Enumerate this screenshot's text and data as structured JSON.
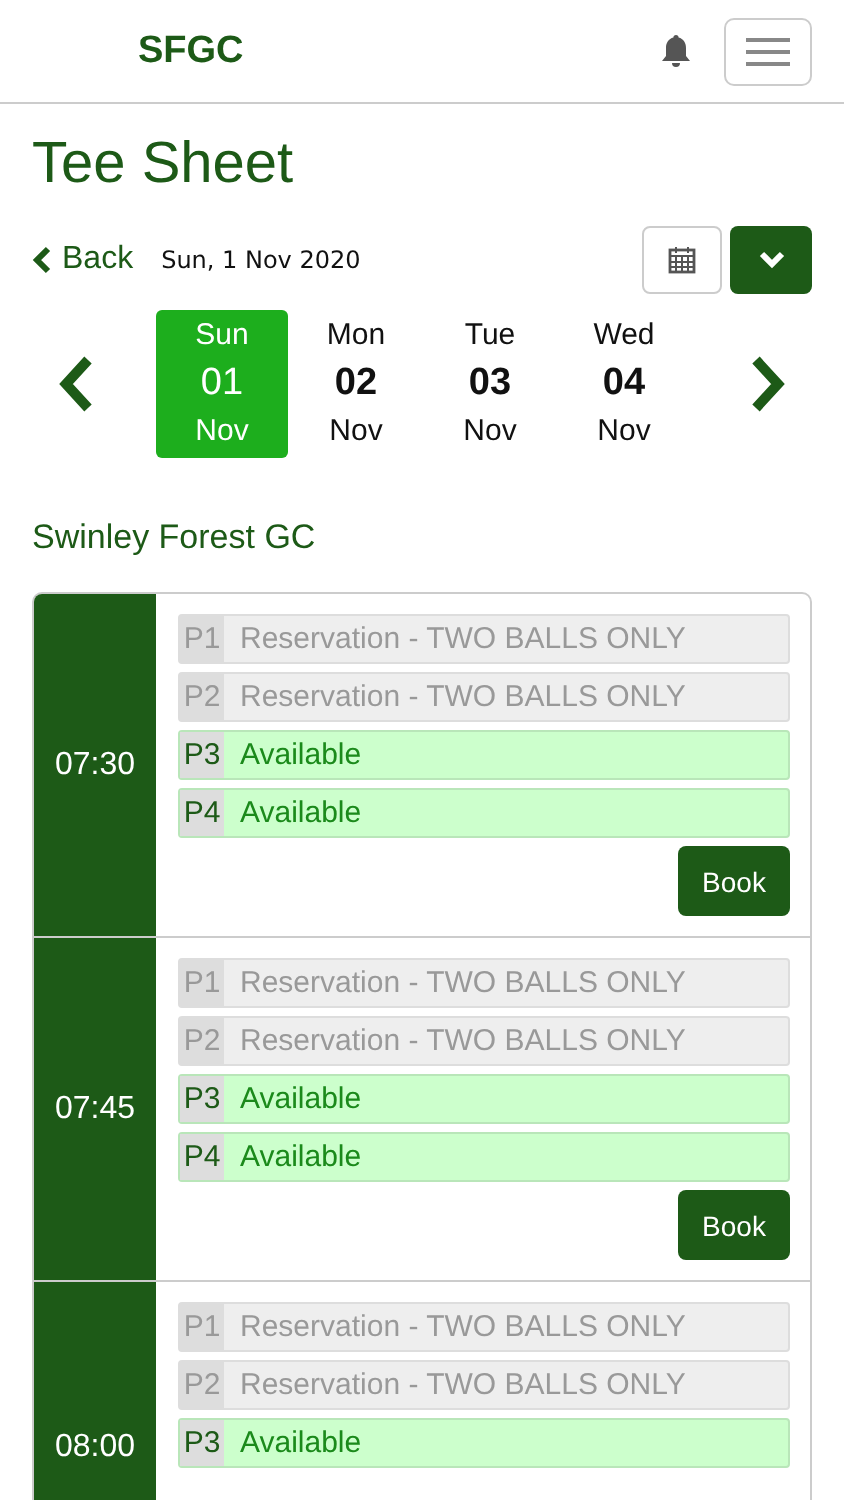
{
  "header": {
    "logo": "SFGC"
  },
  "title": "Tee Sheet",
  "back": {
    "label": "Back"
  },
  "date": "Sun, 1 Nov 2020",
  "days": [
    {
      "weekday": "Sun",
      "day": "01",
      "month": "Nov",
      "selected": true
    },
    {
      "weekday": "Mon",
      "day": "02",
      "month": "Nov",
      "selected": false
    },
    {
      "weekday": "Tue",
      "day": "03",
      "month": "Nov",
      "selected": false
    },
    {
      "weekday": "Wed",
      "day": "04",
      "month": "Nov",
      "selected": false
    }
  ],
  "club": "Swinley Forest GC",
  "slots": [
    {
      "time": "07:30",
      "players": [
        {
          "pos": "P1",
          "text": "Reservation - TWO BALLS ONLY",
          "kind": "reserved"
        },
        {
          "pos": "P2",
          "text": "Reservation - TWO BALLS ONLY",
          "kind": "reserved"
        },
        {
          "pos": "P3",
          "text": "Available",
          "kind": "available"
        },
        {
          "pos": "P4",
          "text": "Available",
          "kind": "available"
        }
      ],
      "button": "Book"
    },
    {
      "time": "07:45",
      "players": [
        {
          "pos": "P1",
          "text": "Reservation - TWO BALLS ONLY",
          "kind": "reserved"
        },
        {
          "pos": "P2",
          "text": "Reservation - TWO BALLS ONLY",
          "kind": "reserved"
        },
        {
          "pos": "P3",
          "text": "Available",
          "kind": "available"
        },
        {
          "pos": "P4",
          "text": "Available",
          "kind": "available"
        }
      ],
      "button": "Book"
    },
    {
      "time": "08:00",
      "players": [
        {
          "pos": "P1",
          "text": "Reservation - TWO BALLS ONLY",
          "kind": "reserved"
        },
        {
          "pos": "P2",
          "text": "Reservation - TWO BALLS ONLY",
          "kind": "reserved"
        },
        {
          "pos": "P3",
          "text": "Available",
          "kind": "available"
        }
      ]
    }
  ]
}
